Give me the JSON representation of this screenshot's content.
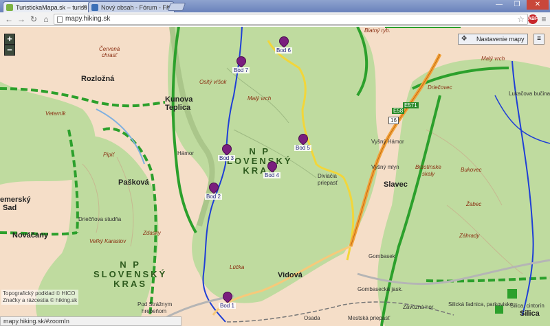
{
  "browser": {
    "tabs": [
      {
        "title": "TuristickaMapa.sk – turisti",
        "active": true
      },
      {
        "title": "Nový obsah - Fórum - Fr",
        "active": false
      }
    ],
    "url": "mapy.hiking.sk",
    "status_url": "mapy.hiking.sk/#zoomIn",
    "extension_badge": "ABP"
  },
  "map": {
    "layer_button": "Nastavenie mapy",
    "zoom_in": "+",
    "zoom_out": "−",
    "np_labels": {
      "center": [
        "N P",
        "LOVENSKÝ",
        "KRAS"
      ],
      "southwest": [
        "N P",
        "SLOVENSKÝ",
        "KRAS"
      ]
    },
    "villages": [
      "Rozložná",
      "Kunova",
      "Teplica",
      "Pašková",
      "Slavec",
      "Vidová",
      "Silica",
      "Nováčany",
      "emerský",
      "Sad"
    ],
    "hills": [
      "Červená",
      "chrasť",
      "Veterník",
      "Pipiť",
      "Ositý vŕšok",
      "Malý vrch",
      "Vyšný Hámor",
      "Vyšný mlyn",
      "Brzotínske",
      "skaly",
      "Bukovec",
      "Žabec",
      "Záhrady",
      "Veľký Karaslov",
      "Zdasky",
      "Lúčka",
      "Driečňova studňa",
      "Diviačia",
      "priepasť",
      "Pod Strážnym",
      "hrebeňom",
      "Malý vrch",
      "Driečovec",
      "Lukačova bučina",
      "Osada",
      "Gombasek",
      "Gombasecká jask.",
      "Závozná hor.",
      "Mestská priepasť",
      "Silická ľadnica, parkovisko",
      "Silica, cintorín",
      "Hámor",
      "Blatný ryb.",
      "E571",
      "E58",
      "16"
    ],
    "markers": [
      {
        "label": "Bod 1"
      },
      {
        "label": "Bod 2"
      },
      {
        "label": "Bod 3"
      },
      {
        "label": "Bod 4"
      },
      {
        "label": "Bod 5"
      },
      {
        "label": "Bod 6"
      },
      {
        "label": "Bod 7"
      }
    ],
    "attribution": [
      "Topografický podklad © HICO",
      "Značky a rázcestia © hiking.sk"
    ],
    "colors": {
      "forest": "#bfdb9f",
      "open_land": "#f5dec8",
      "trail_green": "#2ca02c",
      "trail_blue": "#1f3fd6",
      "trail_yellow": "#f2d63a",
      "road": "#f2a23a",
      "marker": "#7a1e7e"
    }
  }
}
